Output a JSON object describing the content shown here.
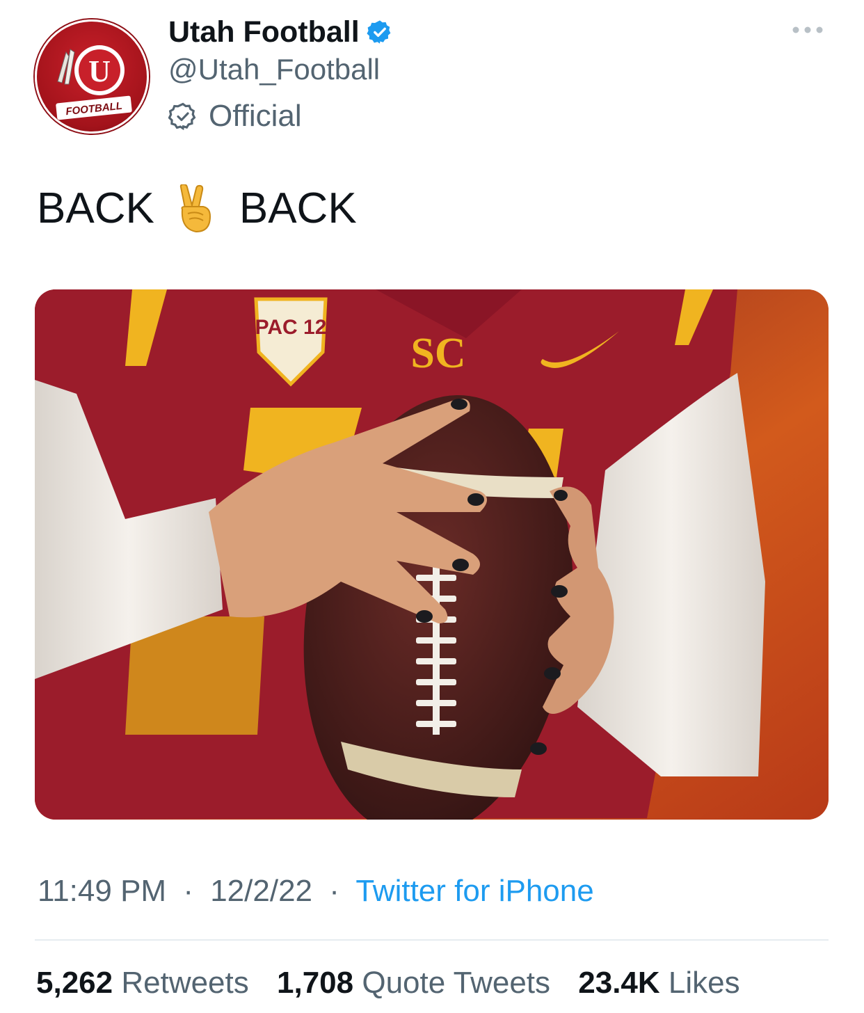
{
  "account": {
    "display_name": "Utah Football",
    "handle": "@Utah_Football",
    "label": "Official",
    "avatar_text": "FOOTBALL",
    "avatar_letter": "U",
    "verified_color": "#1d9bf0"
  },
  "tweet": {
    "text_before": "BACK",
    "emoji": "victory-hand-emoji",
    "text_after": "BACK"
  },
  "media": {
    "patch_text": "PAC 12",
    "logo_text": "SC",
    "colors": {
      "jersey": "#9b1c2b",
      "gold": "#f0b420",
      "sleeve": "#ece7e1",
      "ball": "#4a1f1d"
    }
  },
  "meta": {
    "time": "11:49 PM",
    "date": "12/2/22",
    "separator": "·",
    "source": "Twitter for iPhone"
  },
  "stats": {
    "retweets_count": "5,262",
    "retweets_label": "Retweets",
    "quotes_count": "1,708",
    "quotes_label": "Quote Tweets",
    "likes_count": "23.4K",
    "likes_label": "Likes"
  }
}
